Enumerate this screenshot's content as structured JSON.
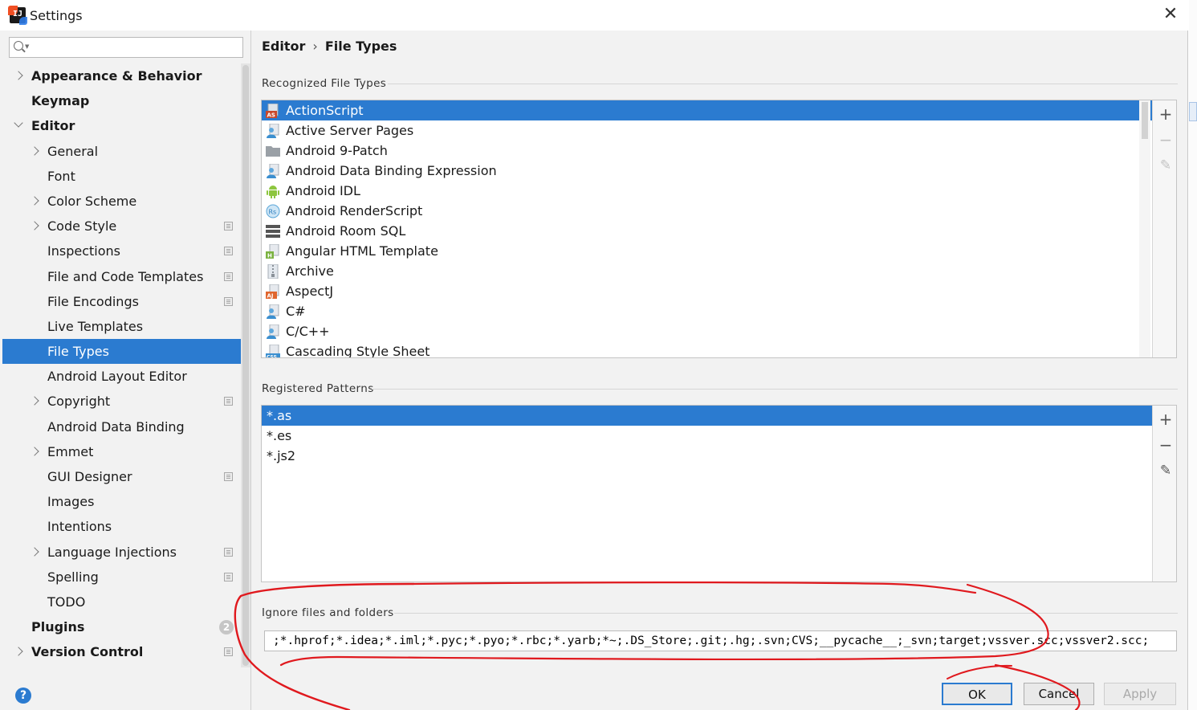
{
  "window": {
    "title": "Settings",
    "close_glyph": "✕"
  },
  "search": {
    "placeholder": ""
  },
  "sidebar": {
    "items": [
      {
        "label": "Appearance & Behavior",
        "level": 0,
        "chevron": "right",
        "project": false
      },
      {
        "label": "Keymap",
        "level": 0,
        "chevron": "none",
        "project": false
      },
      {
        "label": "Editor",
        "level": 0,
        "chevron": "down",
        "project": false
      },
      {
        "label": "General",
        "level": 1,
        "chevron": "right",
        "project": false
      },
      {
        "label": "Font",
        "level": 1,
        "chevron": "none",
        "project": false
      },
      {
        "label": "Color Scheme",
        "level": 1,
        "chevron": "right",
        "project": false
      },
      {
        "label": "Code Style",
        "level": 1,
        "chevron": "right",
        "project": true
      },
      {
        "label": "Inspections",
        "level": 1,
        "chevron": "none",
        "project": true
      },
      {
        "label": "File and Code Templates",
        "level": 1,
        "chevron": "none",
        "project": true
      },
      {
        "label": "File Encodings",
        "level": 1,
        "chevron": "none",
        "project": true
      },
      {
        "label": "Live Templates",
        "level": 1,
        "chevron": "none",
        "project": false
      },
      {
        "label": "File Types",
        "level": 1,
        "chevron": "none",
        "project": false,
        "selected": true
      },
      {
        "label": "Android Layout Editor",
        "level": 1,
        "chevron": "none",
        "project": false
      },
      {
        "label": "Copyright",
        "level": 1,
        "chevron": "right",
        "project": true
      },
      {
        "label": "Android Data Binding",
        "level": 1,
        "chevron": "none",
        "project": false
      },
      {
        "label": "Emmet",
        "level": 1,
        "chevron": "right",
        "project": false
      },
      {
        "label": "GUI Designer",
        "level": 1,
        "chevron": "none",
        "project": true
      },
      {
        "label": "Images",
        "level": 1,
        "chevron": "none",
        "project": false
      },
      {
        "label": "Intentions",
        "level": 1,
        "chevron": "none",
        "project": false
      },
      {
        "label": "Language Injections",
        "level": 1,
        "chevron": "right",
        "project": true
      },
      {
        "label": "Spelling",
        "level": 1,
        "chevron": "none",
        "project": true
      },
      {
        "label": "TODO",
        "level": 1,
        "chevron": "none",
        "project": false
      },
      {
        "label": "Plugins",
        "level": 0,
        "chevron": "none",
        "project": false,
        "badge": "2"
      },
      {
        "label": "Version Control",
        "level": 0,
        "chevron": "right",
        "project": true
      }
    ]
  },
  "breadcrumb": {
    "parent": "Editor",
    "separator": "›",
    "current": "File Types"
  },
  "recognized": {
    "title": "Recognized File Types",
    "items": [
      {
        "label": "ActionScript",
        "icon": "actionscript-icon",
        "selected": true
      },
      {
        "label": "Active Server Pages",
        "icon": "file-user-icon"
      },
      {
        "label": "Android 9-Patch",
        "icon": "folder-icon"
      },
      {
        "label": "Android Data Binding Expression",
        "icon": "file-user-icon"
      },
      {
        "label": "Android IDL",
        "icon": "android-icon"
      },
      {
        "label": "Android RenderScript",
        "icon": "renderscript-icon"
      },
      {
        "label": "Android Room SQL",
        "icon": "database-icon"
      },
      {
        "label": "Angular HTML Template",
        "icon": "html-file-icon"
      },
      {
        "label": "Archive",
        "icon": "archive-icon"
      },
      {
        "label": "AspectJ",
        "icon": "aspectj-icon"
      },
      {
        "label": "C#",
        "icon": "file-user-icon"
      },
      {
        "label": "C/C++",
        "icon": "file-user-icon"
      },
      {
        "label": "Cascading Style Sheet",
        "icon": "css-icon"
      }
    ]
  },
  "patterns": {
    "title": "Registered Patterns",
    "items": [
      {
        "label": "*.as",
        "selected": true
      },
      {
        "label": "*.es"
      },
      {
        "label": "*.js2"
      }
    ]
  },
  "tools": {
    "add": "+",
    "remove": "−",
    "edit": "✎"
  },
  "ignore": {
    "title": "Ignore files and folders",
    "value": ";*.hprof;*.idea;*.iml;*.pyc;*.pyo;*.rbc;*.yarb;*~;.DS_Store;.git;.hg;.svn;CVS;__pycache__;_svn;target;vssver.scc;vssver2.scc;"
  },
  "buttons": {
    "ok": "OK",
    "cancel": "Cancel",
    "apply": "Apply"
  },
  "help": {
    "glyph": "?"
  },
  "colors": {
    "accent": "#2b7bd0",
    "annotation": "#e0191e"
  }
}
